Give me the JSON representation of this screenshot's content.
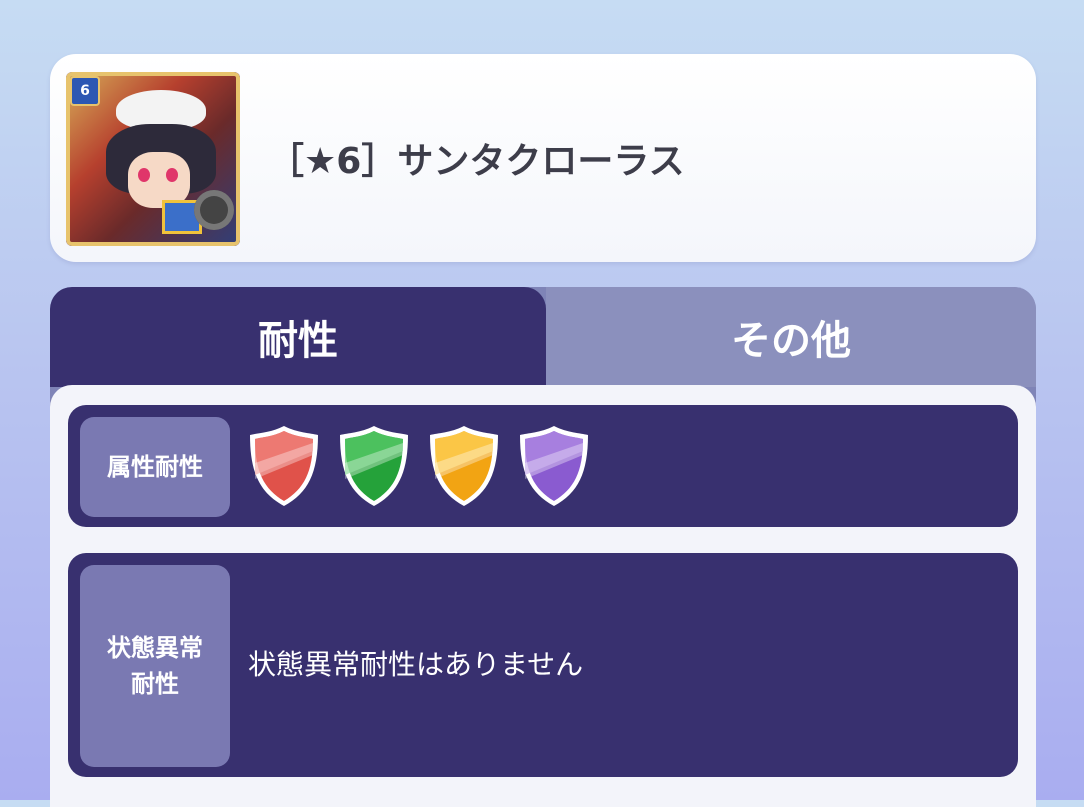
{
  "character": {
    "name": "［★6］サンタクローラス",
    "portrait_badge": "6",
    "portrait_icon": "santa-chroras-portrait"
  },
  "tabs": [
    {
      "label": "耐性",
      "active": true
    },
    {
      "label": "その他",
      "active": false
    }
  ],
  "resistances": {
    "attribute": {
      "label": "属性耐性",
      "shields": [
        {
          "icon": "red-shield-icon",
          "color": "#e0524a"
        },
        {
          "icon": "green-shield-icon",
          "color": "#25a23a"
        },
        {
          "icon": "yellow-shield-icon",
          "color": "#f2a413"
        },
        {
          "icon": "purple-shield-icon",
          "color": "#8a5bd0"
        }
      ]
    },
    "status": {
      "label_line1": "状態異常",
      "label_line2": "耐性",
      "value": "状態異常耐性はありません"
    }
  },
  "colors": {
    "panel_dark": "#38306f",
    "label_bg": "#7a79b2",
    "tab_inactive": "#8b90bd"
  }
}
